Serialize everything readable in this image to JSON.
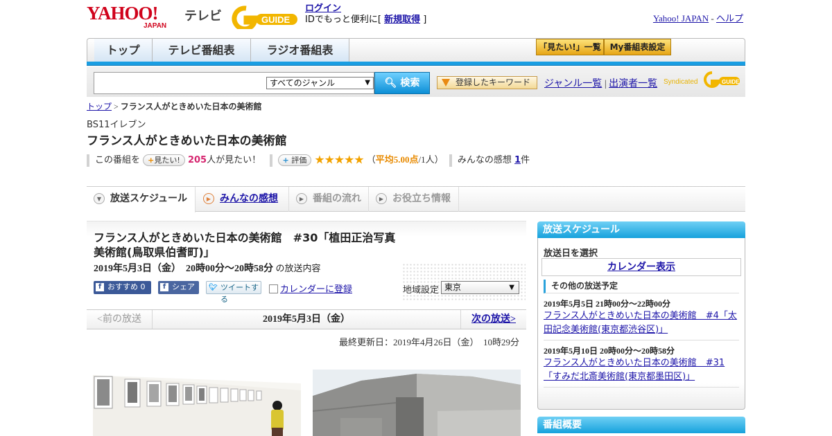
{
  "header": {
    "yahoo_logo": "YAHOO! JAPAN",
    "tv_label": "テレビ",
    "gguide_logo": "G GUIDE",
    "login_link": "ログイン",
    "login_prefix": "IDでもっと便利に[",
    "signup_link": "新規取得",
    "login_suffix": "]",
    "yahoo_japan_link": "Yahoo! JAPAN",
    "separator": "-",
    "help_link": "ヘルプ"
  },
  "nav": {
    "tabs": [
      {
        "label": "トップ"
      },
      {
        "label": "テレビ番組表"
      },
      {
        "label": "ラジオ番組表"
      }
    ],
    "mitai_list": "「見たい!」一覧",
    "my_schedule": "My番組表設定"
  },
  "search": {
    "placeholder": "",
    "genre_selected": "すべてのジャンル",
    "button_label": "検索",
    "keyword_button": "登録したキーワード",
    "genre_list_link": "ジャンル一覧",
    "divider": "|",
    "performer_list_link": "出演者一覧",
    "syndicated": "Syndicated"
  },
  "breadcrumb": {
    "home": "トップ",
    "sep": ">",
    "current": "フランス人がときめいた日本の美術館"
  },
  "program": {
    "channel": "BS11イレブン",
    "title": "フランス人がときめいた日本の美術館",
    "want_prefix": "この番組を",
    "want_button": "見たい!",
    "want_count": "205",
    "want_suffix": "人が見たい！",
    "rate_button": "評価",
    "stars": "★★★★★",
    "rating_open": "（",
    "rating_avg": "平均5.00点",
    "rating_count": "/1人）",
    "impressions_prefix": "みんなの感想",
    "impressions_count": "1",
    "impressions_suffix": "件"
  },
  "tabs": [
    {
      "label": "放送スケジュール",
      "icon": "arrow-down-icon"
    },
    {
      "label": "みんなの感想",
      "icon": "arrow-right-icon"
    },
    {
      "label": "番組の流れ",
      "icon": "arrow-right-icon"
    },
    {
      "label": "お役立ち情報",
      "icon": "arrow-right-icon"
    }
  ],
  "episode": {
    "title": "フランス人がときめいた日本の美術館　#30「植田正治写真美術館(鳥取県伯耆町)」",
    "date_time": "2019年5月3日（金）　20時00分～20時58分",
    "date_suffix": "の放送内容",
    "share_recommend": "おすすめ 0",
    "share_fb": "シェア",
    "share_tweet": "ツイートする",
    "calendar_link": "カレンダーに登録",
    "region_label": "地域設定",
    "region_value": "東京"
  },
  "pager": {
    "prev": "<前の放送",
    "current": "2019年5月3日（金）",
    "next": "次の放送>"
  },
  "updated": "最終更新日：2019年4月26日（金）　10時29分",
  "sidebar": {
    "schedule_title": "放送スケジュール",
    "date_select_label": "放送日を選択",
    "calendar_link": "カレンダー表示",
    "other_title": "その他の放送予定",
    "items": [
      {
        "date": "2019年5月5日  21時00分～22時00分",
        "link": "フランス人がときめいた日本の美術館　#4「太田記念美術館(東京都渋谷区)」"
      },
      {
        "date": "2019年5月10日  20時00分～20時58分",
        "link": "フランス人がときめいた日本の美術館　#31「すみだ北斎美術館(東京都墨田区)」"
      }
    ],
    "overview_title": "番組概要"
  },
  "colors": {
    "accent_blue": "#1a9ee2",
    "link": "#1c14a8",
    "star": "#f2a200",
    "want_count": "#d62670"
  }
}
